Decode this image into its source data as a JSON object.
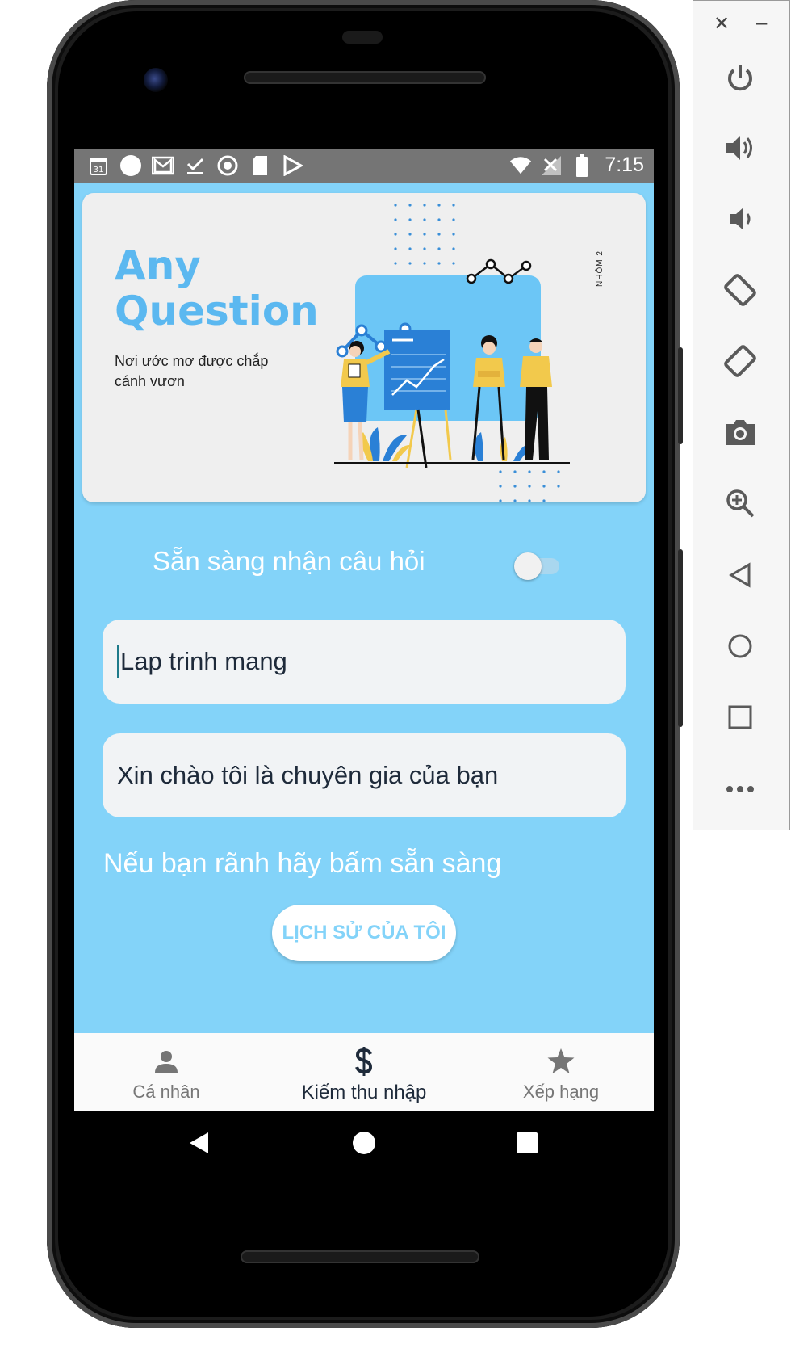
{
  "status_bar": {
    "time": "7:15",
    "left_icons": [
      "calendar-icon",
      "circle-icon",
      "gmail-icon",
      "download-done-icon",
      "radio-icon",
      "sd-card-icon",
      "play-store-icon"
    ],
    "calendar_day": "31",
    "right_icons": [
      "wifi-icon",
      "signal-off-icon",
      "battery-icon"
    ]
  },
  "banner": {
    "title_line1": "Any",
    "title_line2": "Question",
    "subtitle": "Nơi ước mơ được chắp cánh vươn",
    "side_text": "NHÓM 2"
  },
  "toggle": {
    "label": "Sẵn sàng nhận câu hỏi",
    "checked": false
  },
  "fields": {
    "topic_value": "Lap trinh mang",
    "greeting_value": "Xin chào tôi là chuyên gia của bạn"
  },
  "hint": "Nếu bạn rãnh hãy bấm sẵn sàng",
  "history_button": "LỊCH SỬ CỦA TÔI",
  "bottom_nav": {
    "items": [
      {
        "label": "Cá nhân",
        "icon": "person-icon"
      },
      {
        "label": "Kiếm thu nhập",
        "icon": "dollar-icon",
        "active": true
      },
      {
        "label": "Xếp hạng",
        "icon": "star-icon"
      }
    ]
  },
  "colors": {
    "background": "#83d3f9",
    "accent_title": "#5bb8f0",
    "status_bar": "#757575",
    "field": "#f1f3f5",
    "nav_active": "#1e2a3a"
  },
  "emulator_panel": {
    "buttons": [
      "power-icon",
      "volume-up-icon",
      "volume-down-icon",
      "rotate-left-icon",
      "rotate-right-icon",
      "camera-icon",
      "zoom-icon",
      "back-icon",
      "home-icon",
      "overview-icon",
      "more-icon"
    ]
  }
}
